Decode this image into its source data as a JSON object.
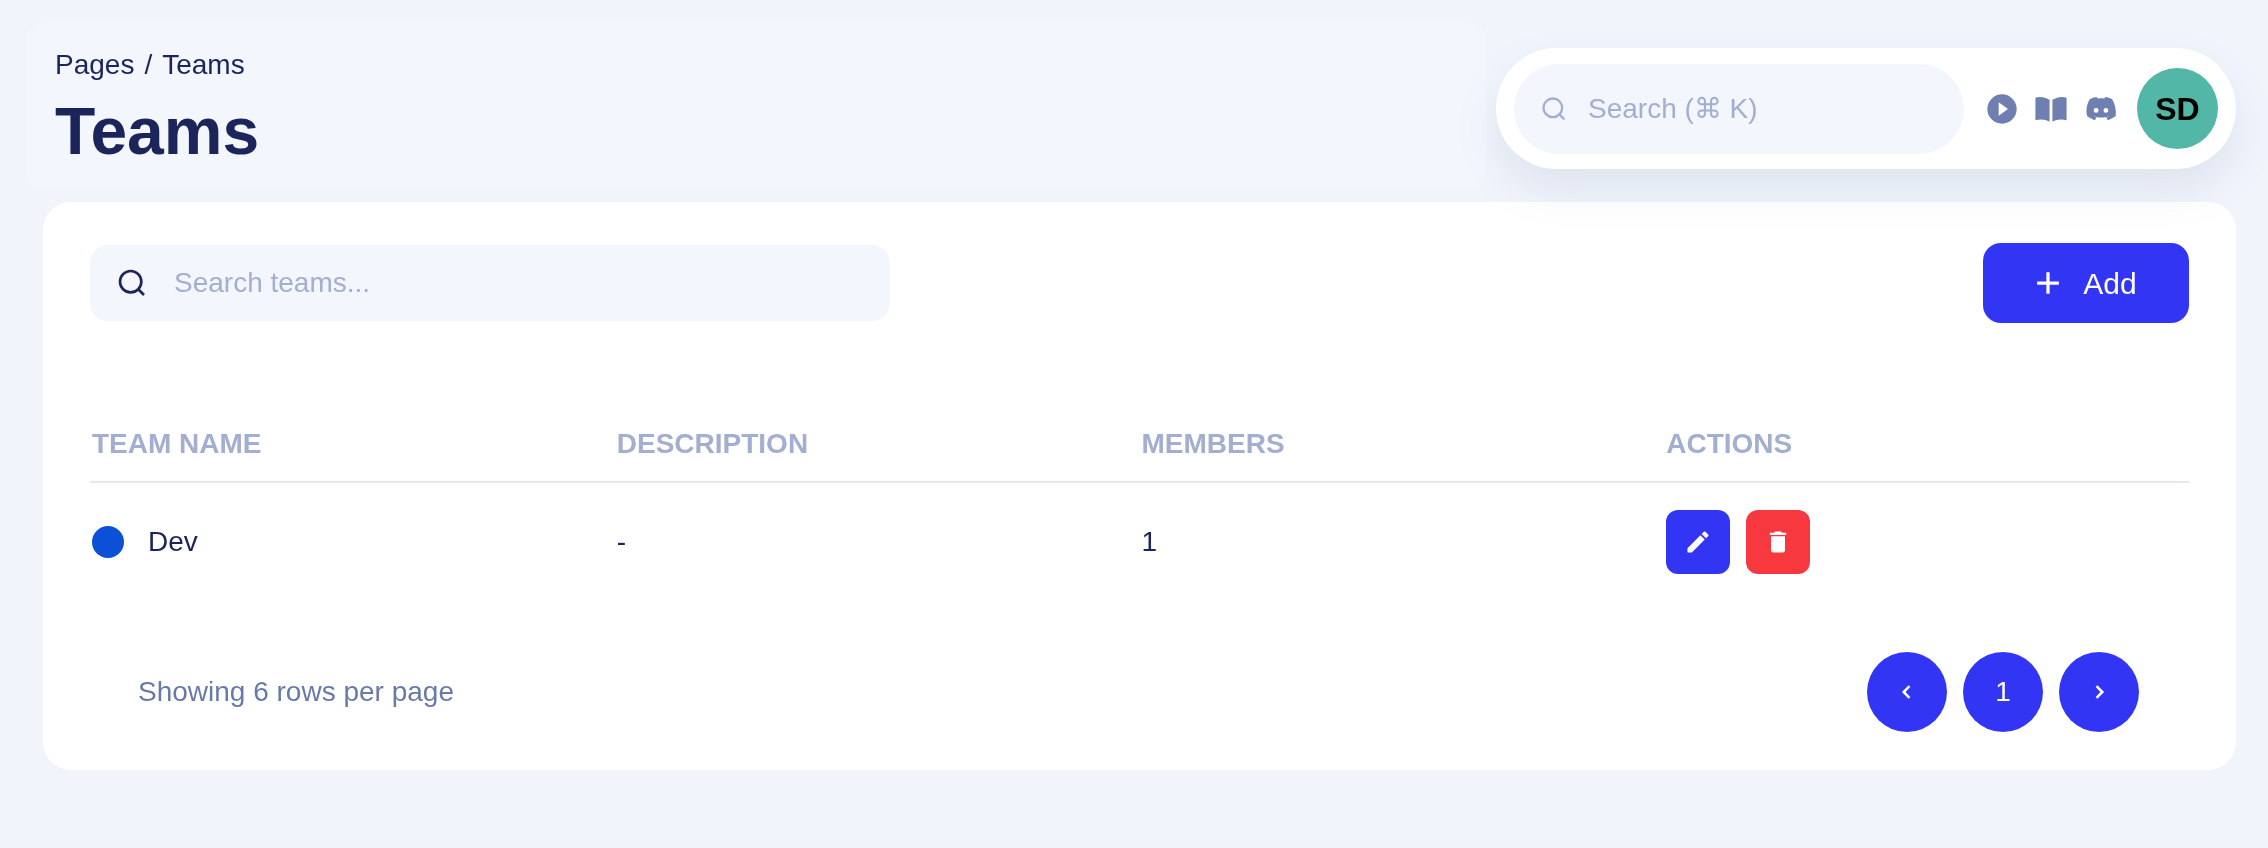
{
  "breadcrumb": {
    "items": [
      "Pages",
      "Teams"
    ],
    "separator": "/"
  },
  "page_title": "Teams",
  "top_search": {
    "placeholder": "Search (⌘ K)"
  },
  "avatar": {
    "initials": "SD"
  },
  "search": {
    "placeholder": "Search teams..."
  },
  "add_button": {
    "label": "Add"
  },
  "table": {
    "columns": [
      "TEAM NAME",
      "DESCRIPTION",
      "MEMBERS",
      "ACTIONS"
    ],
    "rows": [
      {
        "name": "Dev",
        "color": "#0b50d6",
        "description": "-",
        "members": "1"
      }
    ]
  },
  "footer": {
    "text": "Showing 6 rows per page"
  },
  "pagination": {
    "pages": [
      {
        "label": "1",
        "selected": true
      }
    ]
  }
}
